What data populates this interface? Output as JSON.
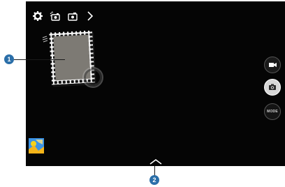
{
  "top_bar": {
    "icons": [
      "settings-icon",
      "camera-effects-icon",
      "switch-camera-icon",
      "expand-chevron-icon"
    ]
  },
  "side_buttons": {
    "video_icon": "video-camera-icon",
    "photo_icon": "camera-shutter-icon",
    "mode_label": "MODE"
  },
  "gallery": {
    "icon": "gallery-thumbnail-icon"
  },
  "bottom": {
    "icon": "chevron-up-icon"
  },
  "callouts": {
    "callout_1": "1",
    "callout_2": "2"
  },
  "colors": {
    "viewfinder_bg": "#050505",
    "callout_badge": "#2b6fa9",
    "gallery_bg": "#2f8be0"
  }
}
